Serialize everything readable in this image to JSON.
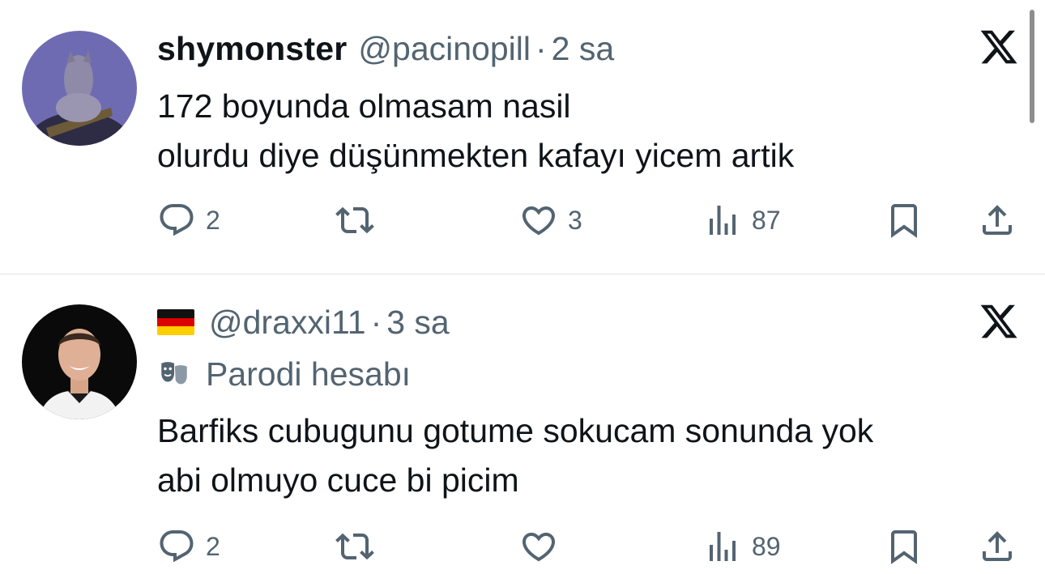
{
  "tweets": [
    {
      "display_name": "shymonster",
      "handle": "@pacinopill",
      "separator": "·",
      "time": "2 sa",
      "text_lines": [
        "172 boyunda olmasam nasil",
        "olurdu diye düşünmekten kafayı yicem artik"
      ],
      "replies": "2",
      "retweets": "",
      "likes": "3",
      "views": "87"
    },
    {
      "flag": "german-flag",
      "handle": "@draxxi11",
      "separator": "·",
      "time": "3 sa",
      "parody_label": "Parodi hesabı",
      "text_lines": [
        "Barfiks cubugunu gotume sokucam sonunda yok",
        "abi olmuyo cuce bi picim"
      ],
      "replies": "2",
      "retweets": "",
      "likes": "",
      "views": "89"
    }
  ],
  "colors": {
    "text": "#0f1419",
    "secondary": "#536471",
    "divider": "#dfe3e6"
  },
  "icons": [
    "reply-icon",
    "retweet-icon",
    "like-icon",
    "views-icon",
    "bookmark-icon",
    "share-icon",
    "x-logo-icon",
    "parody-mask-icon"
  ]
}
